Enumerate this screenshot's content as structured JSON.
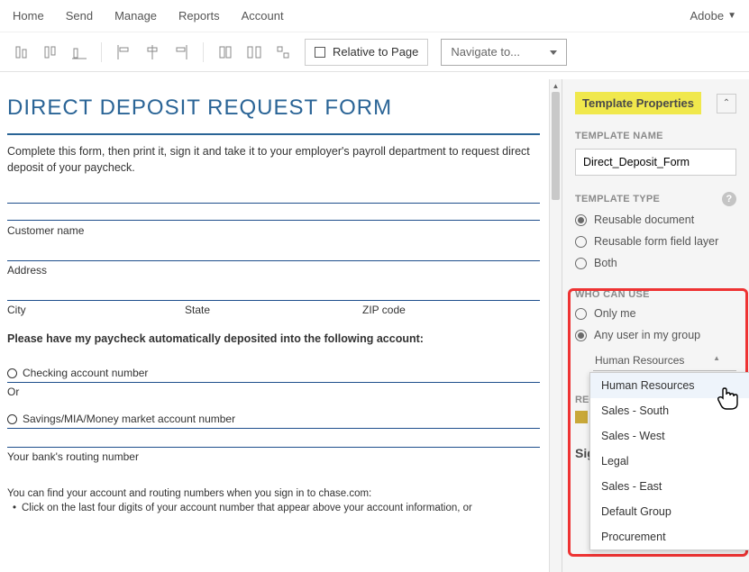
{
  "nav": {
    "items": [
      "Home",
      "Send",
      "Manage",
      "Reports",
      "Account"
    ],
    "brand": "Adobe"
  },
  "toolbar": {
    "relative_page": "Relative to Page",
    "navigate": "Navigate to..."
  },
  "doc": {
    "title": "DIRECT DEPOSIT REQUEST FORM",
    "intro": "Complete this form, then print it, sign it and take it to your employer's payroll department to request direct deposit of your paycheck.",
    "customer_name": "Customer name",
    "address": "Address",
    "city": "City",
    "state": "State",
    "zip": "ZIP code",
    "instruction": "Please have my paycheck automatically deposited into the following account:",
    "checking": "Checking account number",
    "or": "Or",
    "savings": "Savings/MIA/Money market account number",
    "routing": "Your bank's routing number",
    "footer1": "You can find your account and routing numbers when you sign in to chase.com:",
    "footer2": "Click on the last four digits of your account number that appear above your account information, or"
  },
  "panel": {
    "title": "Template Properties",
    "name_label": "TEMPLATE NAME",
    "name_value": "Direct_Deposit_Form",
    "type_label": "TEMPLATE TYPE",
    "type_options": [
      "Reusable document",
      "Reusable form field layer",
      "Both"
    ],
    "type_selected": 0,
    "who_label": "WHO CAN USE",
    "who_options": [
      "Only me",
      "Any user in my group"
    ],
    "who_selected": 1,
    "group_selected": "Human Resources",
    "group_dropdown": [
      "Human Resources",
      "Sales - South",
      "Sales - West",
      "Legal",
      "Sales - East",
      "Default Group",
      "Procurement"
    ],
    "rec_label": "REC",
    "sig_label": "Sig"
  }
}
